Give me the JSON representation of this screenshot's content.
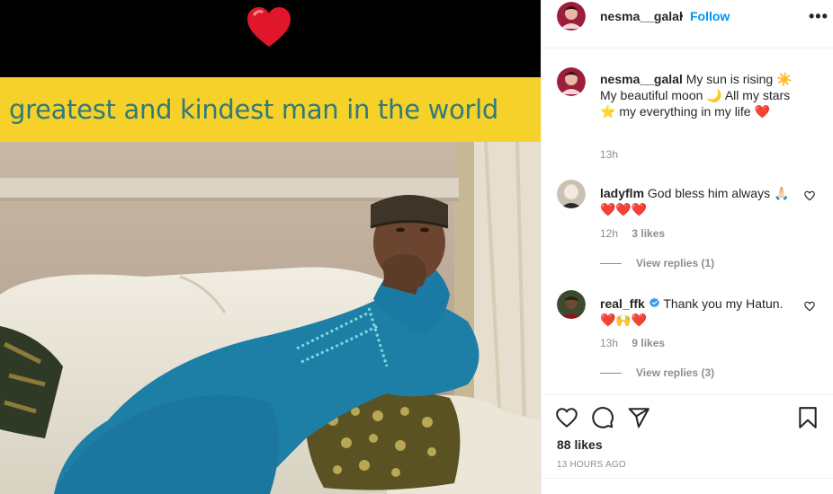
{
  "media": {
    "banner_text": "greatest and kindest man in the world",
    "top_emoji": "❤️"
  },
  "header": {
    "username": "nesma__galal",
    "separator": "•",
    "follow_label": "Follow",
    "more_label": "•••"
  },
  "caption": {
    "username": "nesma__galal",
    "text": "My sun is rising ☀️My beautiful moon 🌙 All my stars ⭐ my everything in my life ❤️",
    "time": "13h"
  },
  "comments": [
    {
      "username": "ladyflm",
      "text": "God bless him always 🙏🏻 ❤️❤️❤️",
      "time": "12h",
      "likes": "3 likes",
      "view_replies": "View replies (1)"
    },
    {
      "username": "real_ffk",
      "verified": true,
      "text": "Thank you my Hatun. ❤️🙌❤️",
      "time": "13h",
      "likes": "9 likes",
      "view_replies": "View replies (3)"
    }
  ],
  "actions": {
    "likes": "88 likes",
    "timestamp": "13 HOURS AGO"
  },
  "icons": {
    "like": "heart-outline-icon",
    "comment": "comment-bubble-icon",
    "share": "paper-plane-icon",
    "save": "bookmark-icon"
  },
  "colors": {
    "follow": "#0095f6",
    "banner_bg": "#f5d12a",
    "banner_text": "#2f7a7c",
    "heart_red": "#c8102e"
  }
}
